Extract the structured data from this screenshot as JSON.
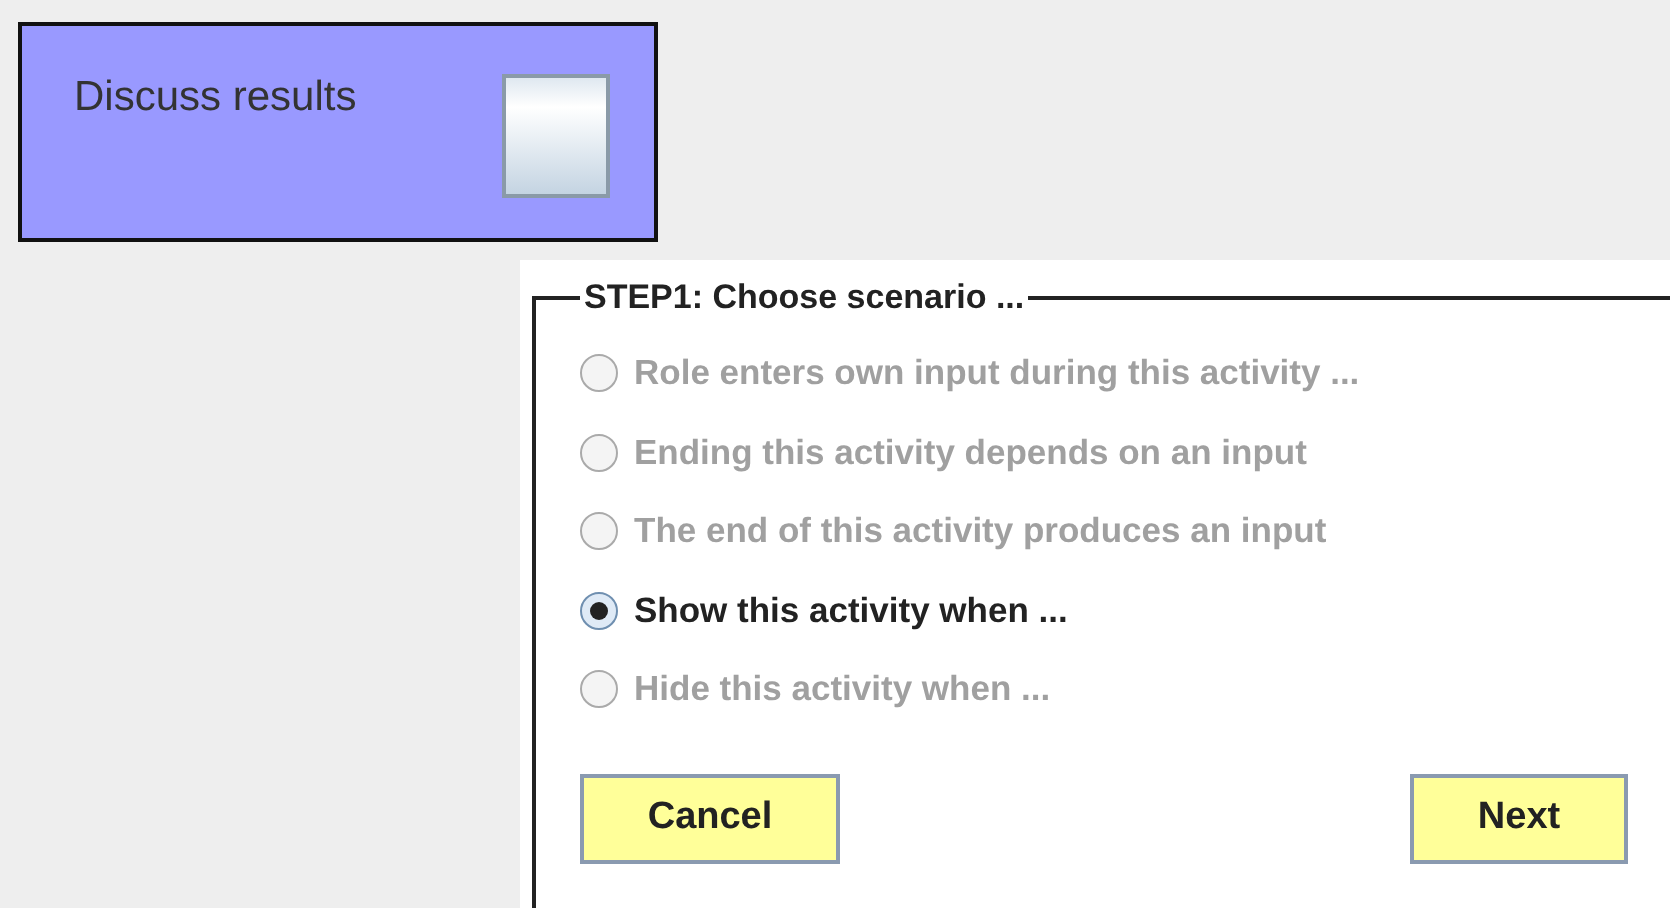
{
  "activity": {
    "title": "Discuss results"
  },
  "scenario_group": {
    "title": "STEP1: Choose scenario ...",
    "options": [
      {
        "label": "Role enters own input during this activity ...",
        "selected": false,
        "disabled": true
      },
      {
        "label": "Ending this activity depends on an input",
        "selected": false,
        "disabled": true
      },
      {
        "label": "The end of this activity produces an input",
        "selected": false,
        "disabled": true
      },
      {
        "label": "Show this activity when ...",
        "selected": true,
        "disabled": false
      },
      {
        "label": "Hide this activity when ...",
        "selected": false,
        "disabled": true
      }
    ]
  },
  "buttons": [
    "Cancel",
    "Next"
  ]
}
